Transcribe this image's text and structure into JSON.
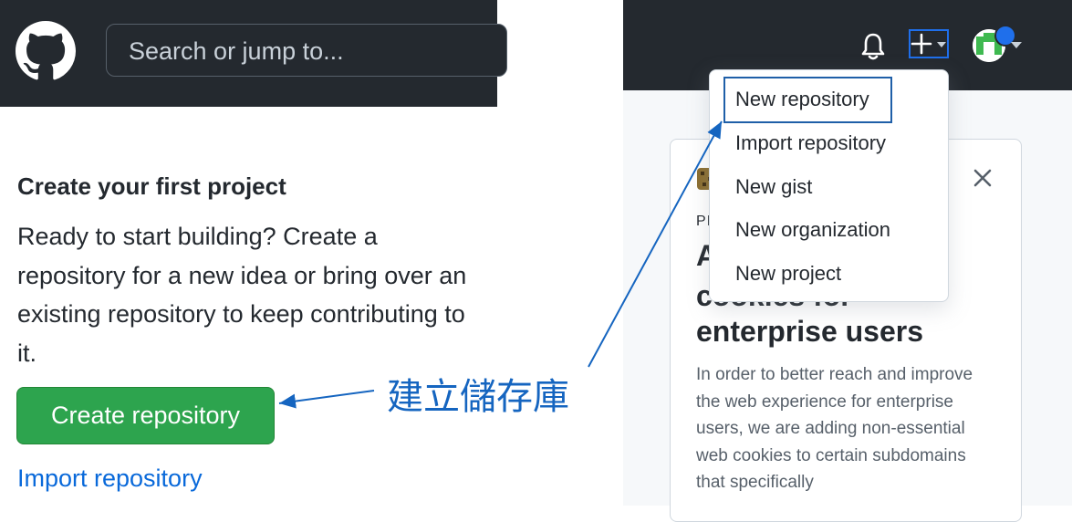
{
  "left": {
    "search_placeholder": "Search or jump to...",
    "first_project_title": "Create your first project",
    "first_project_desc": "Ready to start building? Create a repository for a new idea or bring over an existing repository to keep contributing to it.",
    "create_button": "Create repository",
    "import_link": "Import repository"
  },
  "right": {
    "header_icons": [
      "bell-icon",
      "plus-icon",
      "avatar"
    ],
    "dropdown": {
      "items": [
        "New repository",
        "Import repository",
        "New gist",
        "New organization",
        "New project"
      ]
    },
    "card": {
      "eyebrow": "PI",
      "title_line1": "A",
      "title_line2": "cookies for",
      "title_line3": "enterprise users",
      "body": "In order to better reach and improve the web experience for enterprise users, we are adding non-essential web cookies to certain subdomains that specifically"
    }
  },
  "annotation": {
    "label": "建立儲存庫",
    "color": "#1565c0"
  },
  "colors": {
    "header_bg": "#24292f",
    "primary_green": "#2da44e",
    "link_blue": "#0969da",
    "highlight_blue": "#1f6feb"
  }
}
